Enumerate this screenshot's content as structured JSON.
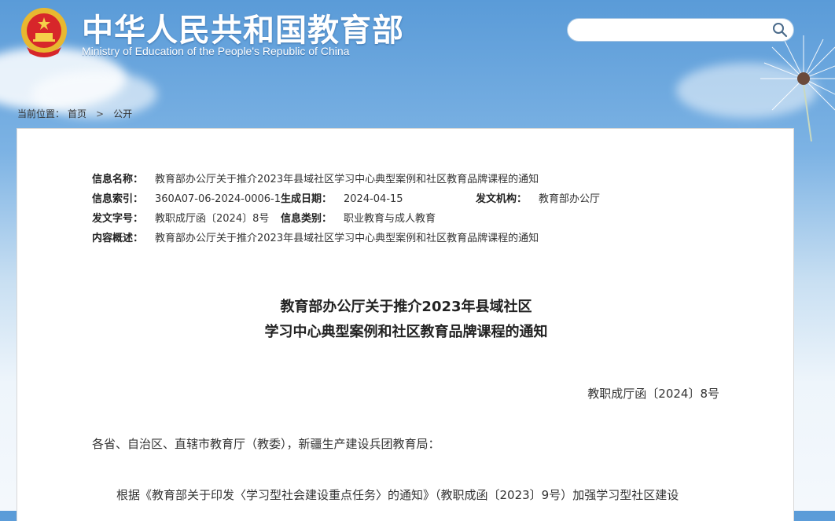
{
  "header": {
    "title": "中华人民共和国教育部",
    "subtitle": "Ministry of Education of the People's Republic of China",
    "search_placeholder": ""
  },
  "breadcrumb": {
    "prefix": "当前位置：",
    "items": [
      "首页",
      "公开"
    ],
    "separator": ">"
  },
  "meta": {
    "name_label": "信息名称：",
    "name_value": "教育部办公厅关于推介2023年县域社区学习中心典型案例和社区教育品牌课程的通知",
    "index_label": "信息索引：",
    "index_value": "360A07-06-2024-0006-1",
    "date_label": "生成日期：",
    "date_value": "2024-04-15",
    "org_label": "发文机构：",
    "org_value": "教育部办公厅",
    "docno_label": "发文字号：",
    "docno_value": "教职成厅函〔2024〕8号",
    "category_label": "信息类别：",
    "category_value": "职业教育与成人教育",
    "summary_label": "内容概述：",
    "summary_value": "教育部办公厅关于推介2023年县域社区学习中心典型案例和社区教育品牌课程的通知"
  },
  "document": {
    "title_line1": "教育部办公厅关于推介2023年县域社区",
    "title_line2": "学习中心典型案例和社区教育品牌课程的通知",
    "number": "教职成厅函〔2024〕8号",
    "salutation": "各省、自治区、直辖市教育厅（教委），新疆生产建设兵团教育局：",
    "paragraph1": "根据《教育部关于印发〈学习型社会建设重点任务〉的通知》（教职成函〔2023〕9号）加强学习型社区建设"
  }
}
